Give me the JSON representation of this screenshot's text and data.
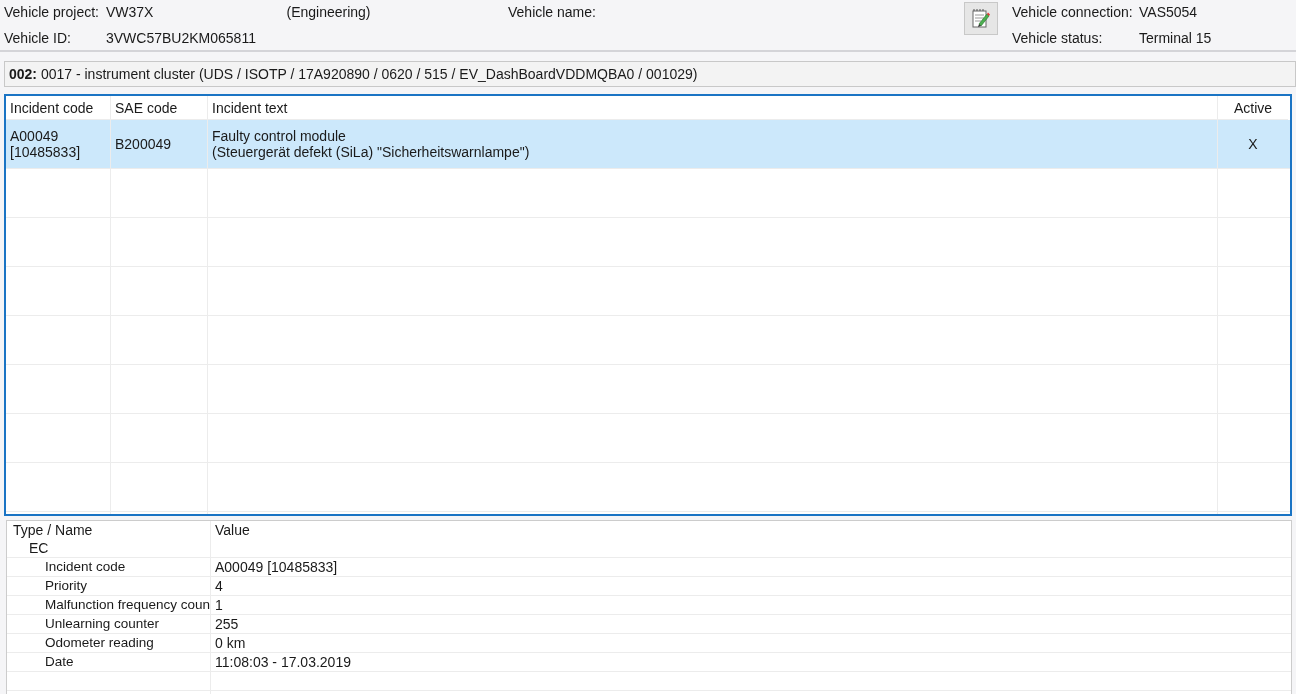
{
  "header": {
    "left": [
      {
        "label": "Vehicle project:",
        "value": "VW37X",
        "note": "(Engineering)"
      },
      {
        "label": "Vehicle ID:",
        "value": "3VWC57BU2KM065811"
      }
    ],
    "middle": [
      {
        "label": "Vehicle name:"
      }
    ],
    "right": [
      {
        "label": "Vehicle connection:",
        "value": "VAS5054"
      },
      {
        "label": "Vehicle status:",
        "value": "Terminal 15"
      }
    ]
  },
  "module": {
    "number": "002:",
    "text": "0017 - instrument cluster  (UDS / ISOTP / 17A920890 / 0620 / 515 / EV_DashBoardVDDMQBA0 / 001029)"
  },
  "incidents": {
    "columns": [
      "Incident code",
      "SAE code",
      "Incident text",
      "Active"
    ],
    "rows": [
      {
        "selected": true,
        "cells": [
          "A00049\n[10485833]",
          "B200049",
          "Faulty control module\n(Steuergerät defekt (SiLa) \"Sicherheitswarnlampe\")",
          "X"
        ]
      }
    ]
  },
  "details": {
    "columns": [
      "Type / Name",
      "Value"
    ],
    "tree": [
      {
        "name": "EC",
        "children": [
          {
            "name": "Incident code",
            "value": "A00049 [10485833]"
          },
          {
            "name": "Priority",
            "value": "4"
          },
          {
            "name": "Malfunction frequency coun",
            "value": "1"
          },
          {
            "name": "Unlearning counter",
            "value": "255"
          },
          {
            "name": "Odometer reading",
            "value": "0 km"
          },
          {
            "name": "Date",
            "value": "11:08:03 - 17.03.2019"
          }
        ]
      }
    ]
  }
}
